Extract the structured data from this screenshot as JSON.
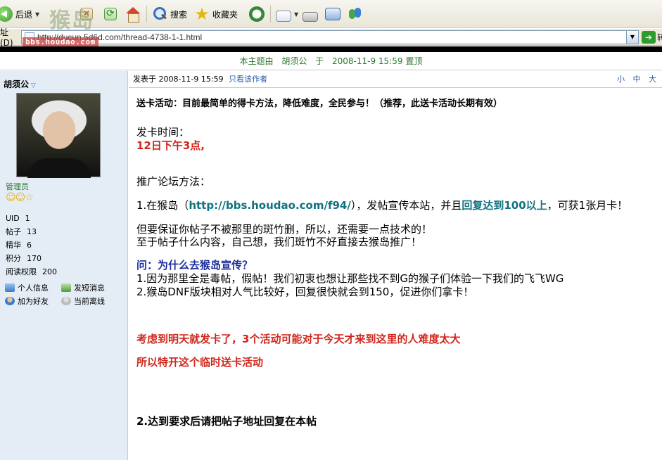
{
  "toolbar": {
    "back_label": "后退",
    "search_label": "搜索",
    "favorites_label": "收藏夹"
  },
  "watermark": {
    "site_name": "猴岛",
    "site_url": "bbs.houdao.com"
  },
  "address": {
    "label": "址(D)",
    "url": "http://ducun.5d6d.com/thread-4738-1-1.html"
  },
  "topic": {
    "label": "本主题由",
    "user": "胡须公",
    "at": "于",
    "datetime": "2008-11-9 15:59",
    "action": "置顶"
  },
  "sidebar": {
    "author": "胡须公",
    "rank": "管理员",
    "stats": [
      {
        "label": "UID",
        "value": "1"
      },
      {
        "label": "帖子",
        "value": "13"
      },
      {
        "label": "精华",
        "value": "6"
      },
      {
        "label": "积分",
        "value": "170"
      },
      {
        "label": "阅读权限",
        "value": "200"
      }
    ],
    "actions": {
      "profile": "个人信息",
      "message": "发短消息",
      "add_friend": "加为好友",
      "status": "当前离线"
    }
  },
  "post_header": {
    "posted_label": "发表于",
    "datetime": "2008-11-9 15:59",
    "only_author": "只看该作者",
    "font_sizes": "小 中 大"
  },
  "post": {
    "title": "送卡活动：目前最简单的得卡方法，降低难度，全民参与！（推荐，此送卡活动长期有效）",
    "issue_time_label": "发卡时间：",
    "issue_time": "12日下午3点,",
    "method_label": "推广论坛方法：",
    "step1_prefix": "1.在猴岛（",
    "step1_link": "http://bbs.houdao.com/f94/",
    "step1_mid": "），发帖宣传本站，并且",
    "step1_highlight": "回复达到100以上",
    "step1_suffix": "，可获1张月卡！",
    "note1": "但要保证你帖子不被那里的斑竹删，所以，还需要一点技术的！",
    "note2": "至于帖子什么内容，自己想，我们斑竹不好直接去猴岛推广！",
    "question": "问：为什么去猴岛宣传？",
    "answer1": "1.因为那里全是毒帖，假帖！我们初衷也想让那些找不到G的猴子们体验一下我们的飞飞WG",
    "answer2": "2.猴岛DNF版块相对人气比较好，回复很快就会到150，促进你们拿卡！",
    "notice1": "考虑到明天就发卡了，3个活动可能对于今天才来到这里的人难度太大",
    "notice2": "所以特开这个临时送卡活动",
    "step2": "2.达到要求后请把帖子地址回复在本帖"
  }
}
